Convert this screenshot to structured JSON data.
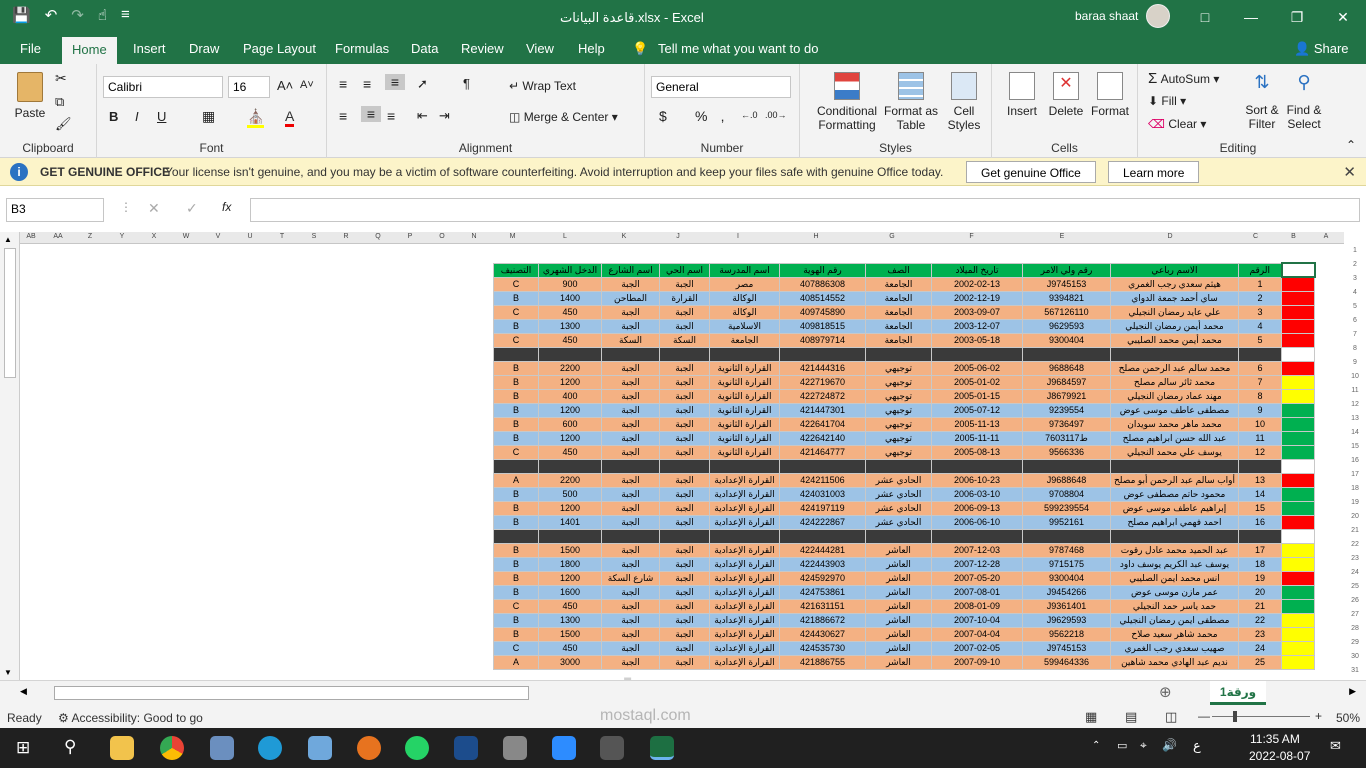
{
  "title_bar": {
    "filename": "قاعدة البيانات.xlsx  -  Excel",
    "user": "baraa shaat"
  },
  "tabs": [
    "File",
    "Home",
    "Insert",
    "Draw",
    "Page Layout",
    "Formulas",
    "Data",
    "Review",
    "View",
    "Help"
  ],
  "tell_me": "Tell me what you want to do",
  "share": "Share",
  "ribbon": {
    "clipboard": {
      "label": "Clipboard",
      "paste": "Paste"
    },
    "font": {
      "label": "Font",
      "name": "Calibri",
      "size": "16"
    },
    "alignment": {
      "label": "Alignment",
      "wrap": "Wrap Text",
      "merge": "Merge & Center"
    },
    "number": {
      "label": "Number",
      "format": "General"
    },
    "styles": {
      "label": "Styles",
      "cond_1": "Conditional",
      "cond_2": "Formatting",
      "table_1": "Format as",
      "table_2": "Table",
      "cell_1": "Cell",
      "cell_2": "Styles"
    },
    "cells": {
      "label": "Cells",
      "insert": "Insert",
      "delete": "Delete",
      "format": "Format"
    },
    "editing": {
      "label": "Editing",
      "autosum": "AutoSum",
      "fill": "Fill",
      "clear": "Clear",
      "sort_1": "Sort &",
      "sort_2": "Filter",
      "find_1": "Find &",
      "find_2": "Select"
    }
  },
  "message_bar": {
    "heading": "GET GENUINE OFFICE",
    "text": "Your license isn't genuine, and you may be a victim of software counterfeiting. Avoid interruption and keep your files safe with genuine Office today.",
    "btn_genuine": "Get genuine Office",
    "btn_learn": "Learn more"
  },
  "formula_bar": {
    "name_box": "B3",
    "fx": "fx",
    "value": ""
  },
  "column_headers": [
    "AB",
    "AA",
    "Z",
    "Y",
    "X",
    "W",
    "V",
    "U",
    "T",
    "S",
    "R",
    "Q",
    "P",
    "O",
    "N",
    "M",
    "L",
    "K",
    "J",
    "I",
    "H",
    "G",
    "F",
    "E",
    "D",
    "C",
    "B",
    "A"
  ],
  "table": {
    "headers": [
      "التصنيف",
      "الدخل الشهري",
      "اسم الشارع",
      "اسم الحي",
      "اسم المدرسة",
      "رقم الهوية",
      "الصف",
      "تاريخ الميلاد",
      "رقم ولي الامر",
      "الاسم رباعي",
      "الرقم"
    ],
    "colors": {
      "header": "#00b050",
      "orange": "#f4b183",
      "blue": "#9dc3e6",
      "dark": "#3a3a3a",
      "red": "#ff0000",
      "yellow": "#ffff00",
      "green": "#00b050",
      "white": "#ffffff"
    },
    "rows": [
      {
        "style": "orange",
        "status": "red",
        "cells": [
          "C",
          "900",
          "الجبة",
          "الجبة",
          "مصر",
          "407886308",
          "الجامعة",
          "2002-02-13",
          "J9745153",
          "هيثم سعدي رجب الغمري",
          "1"
        ]
      },
      {
        "style": "blue",
        "status": "red",
        "cells": [
          "B",
          "1400",
          "المطاحن",
          "القرارة",
          "الوكالة",
          "408514552",
          "الجامعة",
          "2002-12-19",
          "9394821",
          "ساي أحمد جمعة الدواي",
          "2"
        ]
      },
      {
        "style": "orange",
        "status": "red",
        "cells": [
          "C",
          "450",
          "الجبة",
          "الجبة",
          "الوكالة",
          "409745890",
          "الجامعة",
          "2003-09-07",
          "567126110",
          "علي عايد رمضان النجيلي",
          "3"
        ]
      },
      {
        "style": "blue",
        "status": "red",
        "cells": [
          "B",
          "1300",
          "الجبة",
          "الجبة",
          "الاسلامية",
          "409818515",
          "الجامعة",
          "2003-12-07",
          "9629593",
          "محمد أيمن رمضان النجيلي",
          "4"
        ]
      },
      {
        "style": "orange",
        "status": "red",
        "cells": [
          "C",
          "450",
          "السكة",
          "السكة",
          "الجامعة",
          "408979714",
          "الجامعة",
          "2003-05-18",
          "9300404",
          "محمد أيمن محمد الصليبي",
          "5"
        ]
      },
      {
        "style": "dark",
        "status": "white",
        "cells": [
          "",
          "",
          "",
          "",
          "",
          "",
          "",
          "",
          "",
          "",
          ""
        ]
      },
      {
        "style": "orange",
        "status": "red",
        "cells": [
          "B",
          "2200",
          "الجبة",
          "الجبة",
          "القرارة الثانوية",
          "421444316",
          "توجيهي",
          "2005-06-02",
          "9688648",
          "محمد سالم عبد الرحمن مصلح",
          "6"
        ]
      },
      {
        "style": "orange",
        "status": "yellow",
        "cells": [
          "B",
          "1200",
          "الجبة",
          "الجبة",
          "القرارة الثانوية",
          "422719670",
          "توجيهي",
          "2005-01-02",
          "J9684597",
          "محمد ثائر سالم مصلح",
          "7"
        ]
      },
      {
        "style": "orange",
        "status": "yellow",
        "cells": [
          "B",
          "400",
          "الجبة",
          "الجبة",
          "القرارة الثانوية",
          "422724872",
          "توجيهي",
          "2005-01-15",
          "J8679921",
          "مهند عماد رمضان النجيلي",
          "8"
        ]
      },
      {
        "style": "blue",
        "status": "green",
        "cells": [
          "B",
          "1200",
          "الجبة",
          "الجبة",
          "القرارة الثانوية",
          "421447301",
          "توجيهي",
          "2005-07-12",
          "9239554",
          "مصطفى عاطف موسى عوض",
          "9"
        ]
      },
      {
        "style": "orange",
        "status": "green",
        "cells": [
          "B",
          "600",
          "الجبة",
          "الجبة",
          "القرارة الثانوية",
          "422641704",
          "توجيهي",
          "2005-11-13",
          "9736497",
          "محمد ماهر محمد سويدان",
          "10"
        ]
      },
      {
        "style": "blue",
        "status": "green",
        "cells": [
          "B",
          "1200",
          "الجبة",
          "الجبة",
          "القرارة الثانوية",
          "422642140",
          "توجيهي",
          "2005-11-11",
          "ط7603117",
          "عبد الله حسن ابراهيم مصلح",
          "11"
        ]
      },
      {
        "style": "orange",
        "status": "green",
        "cells": [
          "C",
          "450",
          "الجبة",
          "الجبة",
          "القرارة الثانوية",
          "421464777",
          "توجيهي",
          "2005-08-13",
          "9566336",
          "يوسف علي محمد النجيلي",
          "12"
        ]
      },
      {
        "style": "dark",
        "status": "white",
        "cells": [
          "",
          "",
          "",
          "",
          "",
          "",
          "",
          "",
          "",
          "",
          ""
        ]
      },
      {
        "style": "orange",
        "status": "red",
        "cells": [
          "A",
          "2200",
          "الجبة",
          "الجبة",
          "القرارة الإعدادية",
          "424211506",
          "الحادي عشر",
          "2006-10-23",
          "J9688648",
          "أواب سالم عبد الرحمن أبو مصلح",
          "13"
        ]
      },
      {
        "style": "blue",
        "status": "green",
        "cells": [
          "B",
          "500",
          "الجبة",
          "الجبة",
          "القرارة الإعدادية",
          "424031003",
          "الحادي عشر",
          "2006-03-10",
          "9708804",
          "محمود حاتم مصطفى عوض",
          "14"
        ]
      },
      {
        "style": "orange",
        "status": "green",
        "cells": [
          "B",
          "1200",
          "الجبة",
          "الجبة",
          "القرارة الإعدادية",
          "424197119",
          "الحادي عشر",
          "2006-09-13",
          "599239554",
          "إبراهيم عاطف موسى عوض",
          "15"
        ]
      },
      {
        "style": "blue",
        "status": "red",
        "cells": [
          "B",
          "1401",
          "الجبة",
          "الجبة",
          "القرارة الإعدادية",
          "424222867",
          "الحادي عشر",
          "2006-06-10",
          "9952161",
          "احمد فهمي ابراهيم مصلح",
          "16"
        ]
      },
      {
        "style": "dark",
        "status": "white",
        "cells": [
          "",
          "",
          "",
          "",
          "",
          "",
          "",
          "",
          "",
          "",
          ""
        ]
      },
      {
        "style": "orange",
        "status": "yellow",
        "cells": [
          "B",
          "1500",
          "الجبة",
          "الجبة",
          "القرارة الإعدادية",
          "422444281",
          "العاشر",
          "2007-12-03",
          "9787468",
          "عبد الحميد محمد عادل رقوت",
          "17"
        ]
      },
      {
        "style": "blue",
        "status": "yellow",
        "cells": [
          "B",
          "1800",
          "الجبة",
          "الجبة",
          "القرارة الإعدادية",
          "422443903",
          "العاشر",
          "2007-12-28",
          "9715175",
          "يوسف عبد الكريم يوسف داود",
          "18"
        ]
      },
      {
        "style": "orange",
        "status": "red",
        "cells": [
          "B",
          "1200",
          "شارع السكة",
          "الجبة",
          "القرارة الإعدادية",
          "424592970",
          "العاشر",
          "2007-05-20",
          "9300404",
          "انس محمد ايمن الصليبي",
          "19"
        ]
      },
      {
        "style": "blue",
        "status": "green",
        "cells": [
          "B",
          "1600",
          "الجبة",
          "الجبة",
          "القرارة الإعدادية",
          "424753861",
          "العاشر",
          "2007-08-01",
          "J9454266",
          "عمر مازن موسى عوض",
          "20"
        ]
      },
      {
        "style": "orange",
        "status": "green",
        "cells": [
          "C",
          "450",
          "الجبة",
          "الجبة",
          "القرارة الإعدادية",
          "421631151",
          "العاشر",
          "2008-01-09",
          "J9361401",
          "حمد ياسر حمد النجيلي",
          "21"
        ]
      },
      {
        "style": "blue",
        "status": "yellow",
        "cells": [
          "B",
          "1300",
          "الجبة",
          "الجبة",
          "القرارة الإعدادية",
          "421886672",
          "العاشر",
          "2007-10-04",
          "J9629593",
          "مصطفى ايمن رمضان النجيلي",
          "22"
        ]
      },
      {
        "style": "orange",
        "status": "yellow",
        "cells": [
          "B",
          "1500",
          "الجبة",
          "الجبة",
          "القرارة الإعدادية",
          "424430627",
          "العاشر",
          "2007-04-04",
          "9562218",
          "محمد شاهر سعيد صلاح",
          "23"
        ]
      },
      {
        "style": "blue",
        "status": "yellow",
        "cells": [
          "C",
          "450",
          "الجبة",
          "الجبة",
          "القرارة الإعدادية",
          "424535730",
          "العاشر",
          "2007-02-05",
          "J9745153",
          "صهيب سعدي رجب الغمري",
          "24"
        ]
      },
      {
        "style": "orange",
        "status": "yellow",
        "cells": [
          "A",
          "3000",
          "الجبة",
          "الجبة",
          "القرارة الإعدادية",
          "421886755",
          "العاشر",
          "2007-09-10",
          "599464336",
          "نديم عبد الهادي محمد شاهين",
          "25"
        ]
      }
    ]
  },
  "row_numbers": [
    "1",
    "2",
    "3",
    "4",
    "5",
    "6",
    "7",
    "8",
    "9",
    "10",
    "11",
    "12",
    "13",
    "14",
    "15",
    "16",
    "17",
    "18",
    "19",
    "20",
    "21",
    "22",
    "23",
    "24",
    "25",
    "26",
    "27",
    "28",
    "29",
    "30",
    "31"
  ],
  "sheet_tab": "ورقة1",
  "status": {
    "ready": "Ready",
    "accessibility": "Accessibility: Good to go",
    "zoom": "50%"
  },
  "watermark": {
    "text1": "مستقل",
    "text2": "mostaql.com"
  },
  "taskbar": {
    "time": "11:35 AM",
    "date": "2022-08-07",
    "lang": "ع"
  }
}
